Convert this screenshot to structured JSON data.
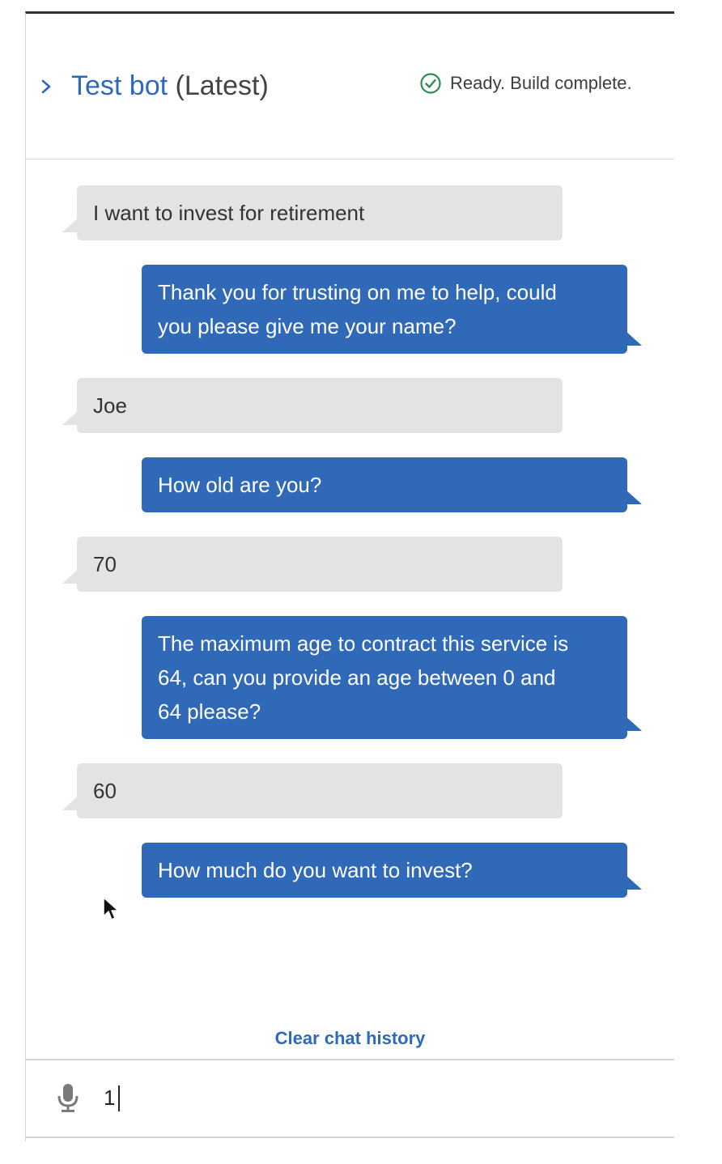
{
  "header": {
    "bot_name": "Test bot",
    "version": "(Latest)",
    "status": "Ready. Build complete.",
    "status_color": "#2e8b57",
    "accent_color": "#2e6ab8"
  },
  "messages": [
    {
      "sender": "user",
      "lines": [
        "I want to invest for retirement"
      ]
    },
    {
      "sender": "bot",
      "lines": [
        "Thank you for trusting on me to help, could",
        "you please give me your name?"
      ]
    },
    {
      "sender": "user",
      "lines": [
        "Joe"
      ]
    },
    {
      "sender": "bot",
      "lines": [
        "How old are you?"
      ]
    },
    {
      "sender": "user",
      "lines": [
        "70"
      ]
    },
    {
      "sender": "bot",
      "lines": [
        "The maximum age to contract this service is",
        "64, can you provide an age between 0 and",
        "64 please?"
      ]
    },
    {
      "sender": "user",
      "lines": [
        "60"
      ]
    },
    {
      "sender": "bot",
      "lines": [
        "How much do you want to invest?"
      ]
    }
  ],
  "clear_label": "Clear chat history",
  "input": {
    "value": "1",
    "icon": "microphone-icon"
  }
}
